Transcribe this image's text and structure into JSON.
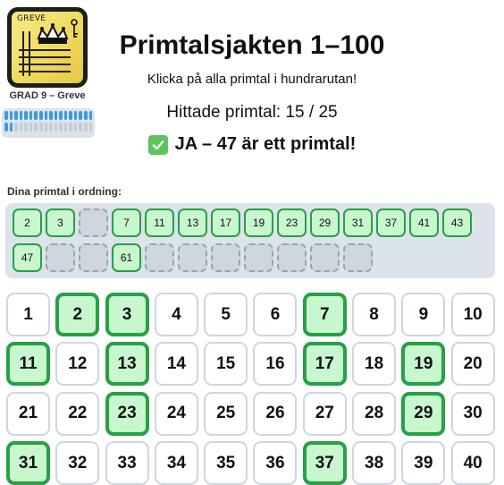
{
  "badge": {
    "title": "GREVE",
    "grade": "GRAD 9 – Greve",
    "xp_filled_row1": 18,
    "xp_filled_row2": 2,
    "xp_total_per_row": 18
  },
  "header": {
    "title": "Primtalsjakten 1–100",
    "subtitle": "Klicka på alla primtal i hundrarutan!",
    "counter": "Hittade primtal: 15 / 25"
  },
  "status": {
    "text": "JA – 47 är ett primtal!",
    "icon": "check-icon"
  },
  "found": {
    "label": "Dina primtal i ordning:",
    "slots": [
      "2",
      "3",
      "",
      "7",
      "11",
      "13",
      "17",
      "19",
      "23",
      "29",
      "31",
      "37",
      "41",
      "43",
      "47",
      "",
      "",
      "61",
      "",
      "",
      "",
      "",
      "",
      "",
      ""
    ]
  },
  "grid": {
    "numbers": [
      1,
      2,
      3,
      4,
      5,
      6,
      7,
      8,
      9,
      10,
      11,
      12,
      13,
      14,
      15,
      16,
      17,
      18,
      19,
      20,
      21,
      22,
      23,
      24,
      25,
      26,
      27,
      28,
      29,
      30,
      31,
      32,
      33,
      34,
      35,
      36,
      37,
      38,
      39,
      40
    ],
    "highlighted": [
      2,
      3,
      7,
      11,
      13,
      17,
      19,
      23,
      29,
      31,
      37
    ]
  },
  "colors": {
    "accent": "#27a046",
    "accent_bg": "#c8f6cf",
    "xp": "#3b9be0"
  }
}
